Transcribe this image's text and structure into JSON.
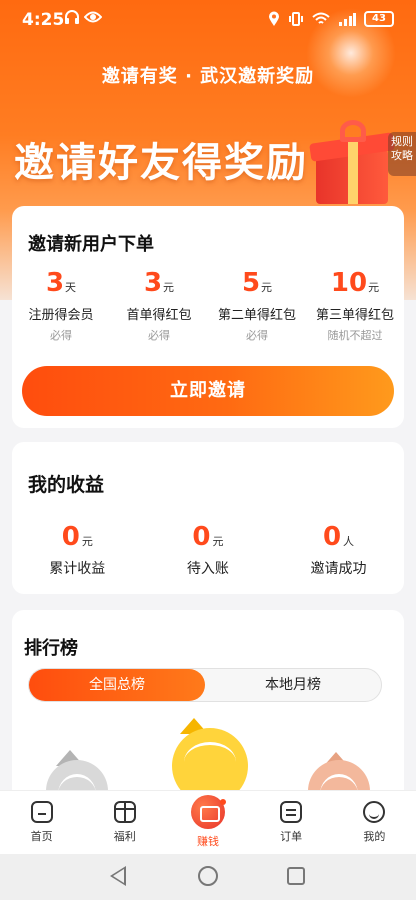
{
  "status_bar": {
    "time": "4:25",
    "battery": "43",
    "left_icons": [
      "headphones-icon",
      "eye-icon"
    ],
    "right_icons": [
      "location-icon",
      "vibrate-icon",
      "wifi-icon",
      "signal-icon",
      "battery-icon"
    ]
  },
  "hero": {
    "subtitle": "邀请有奖 · 武汉邀新奖励",
    "title": "邀请好友得奖励",
    "side_tab": [
      "规则",
      "攻略"
    ]
  },
  "invite_card": {
    "title": "邀请新用户下单",
    "rewards": [
      {
        "value": "3",
        "unit": "天",
        "label": "注册得会员",
        "note": "必得"
      },
      {
        "value": "3",
        "unit": "元",
        "label": "首单得红包",
        "note": "必得"
      },
      {
        "value": "5",
        "unit": "元",
        "label": "第二单得红包",
        "note": "必得"
      },
      {
        "value": "10",
        "unit": "元",
        "label": "第三单得红包",
        "note": "随机不超过"
      }
    ],
    "button": "立即邀请"
  },
  "earnings_card": {
    "title": "我的收益",
    "items": [
      {
        "value": "0",
        "unit": "元",
        "label": "累计收益"
      },
      {
        "value": "0",
        "unit": "元",
        "label": "待入账"
      },
      {
        "value": "0",
        "unit": "人",
        "label": "邀请成功"
      }
    ]
  },
  "ranking_card": {
    "title": "排行榜",
    "tabs": [
      {
        "label": "全国总榜",
        "active": true
      },
      {
        "label": "本地月榜",
        "active": false
      }
    ]
  },
  "bottom_nav": [
    {
      "label": "首页",
      "icon": "home-icon"
    },
    {
      "label": "福利",
      "icon": "gift-icon"
    },
    {
      "label": "赚钱",
      "icon": "money-envelope-icon",
      "active": true
    },
    {
      "label": "订单",
      "icon": "order-icon"
    },
    {
      "label": "我的",
      "icon": "profile-icon"
    }
  ],
  "colors": {
    "accent": "#ff4a1c",
    "hero_top": "#ff6a10",
    "button_start": "#ff4d0e",
    "button_end": "#ff9a1c"
  }
}
